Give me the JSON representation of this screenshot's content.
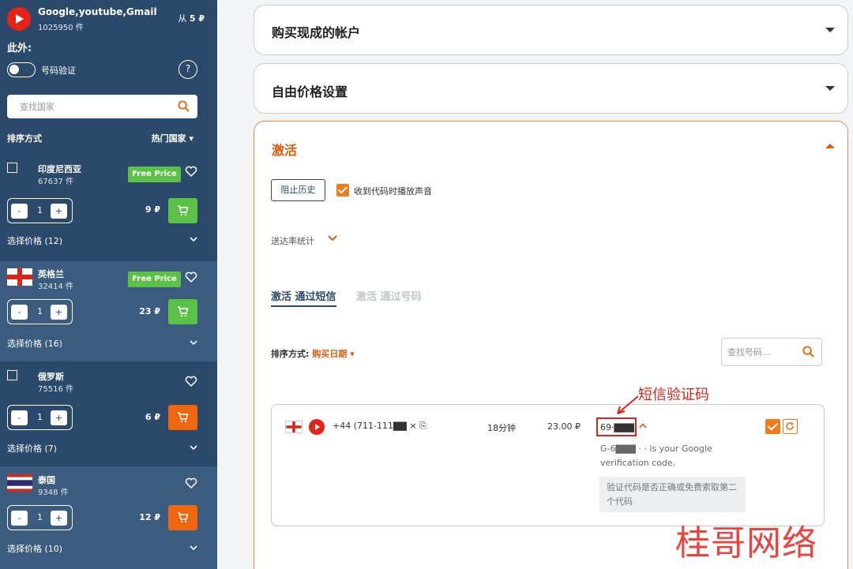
{
  "service": {
    "name": "Google,youtube,Gmail",
    "count": "1025950 件",
    "price_prefix": "从",
    "price": "5 ₽"
  },
  "sidebar": {
    "also_label": "此外:",
    "toggle_label": "号码验证",
    "help_label": "?",
    "search_placeholder": "查找国家",
    "sort_label": "排序方式",
    "sort_value": "热门国家 ▾",
    "countries": [
      {
        "name": "印度尼西亚",
        "count": "67637 件",
        "badge": "Free Price",
        "qty": "1",
        "price": "9 ₽",
        "choose": "选择价格 (12)",
        "cart_color": "#5cc247"
      },
      {
        "name": "英格兰",
        "count": "32414 件",
        "badge": "Free Price",
        "qty": "1",
        "price": "23 ₽",
        "choose": "选择价格 (16)",
        "cart_color": "#5cc247"
      },
      {
        "name": "俄罗斯",
        "count": "75516 件",
        "badge": "",
        "qty": "1",
        "price": "6 ₽",
        "choose": "选择价格 (7)",
        "cart_color": "#f0660c"
      },
      {
        "name": "泰国",
        "count": "9348 件",
        "badge": "",
        "qty": "1",
        "price": "12 ₽",
        "choose": "选择价格 (10)",
        "cart_color": "#f0660c"
      }
    ],
    "minus": "-",
    "plus": "+"
  },
  "main": {
    "panels": {
      "ready": "购买现成的帐户",
      "free_price": "自由价格设置",
      "activation": "激活"
    },
    "history_button": "阻止历史",
    "sound_label": "收到代码时播放声音",
    "stats_label": "送达率统计",
    "tab_sms": "激活 通过短信",
    "tab_call": "激活 通过号码",
    "sort_label": "排序方式:",
    "sort_value": "购买日期 ▾",
    "number_search_placeholder": "查找号码...",
    "row": {
      "phone": "+44 (711-111▇▇ × ⎘",
      "time": "18分钟",
      "price": "23.00 ₽",
      "code": "69·▇▇▇",
      "message": "G-6▇▇▇ · · is your Google verification code.",
      "hint": "验证代码是否正确或免费索取第二个代码"
    }
  },
  "annotation": "短信验证码",
  "watermark": "桂哥网络",
  "colors": {
    "sidebar": "#2b4a6b",
    "sidebar_alt": "#3b5c7f",
    "accent": "#e05a0c",
    "green": "#5cc247",
    "orange": "#f0660c"
  }
}
